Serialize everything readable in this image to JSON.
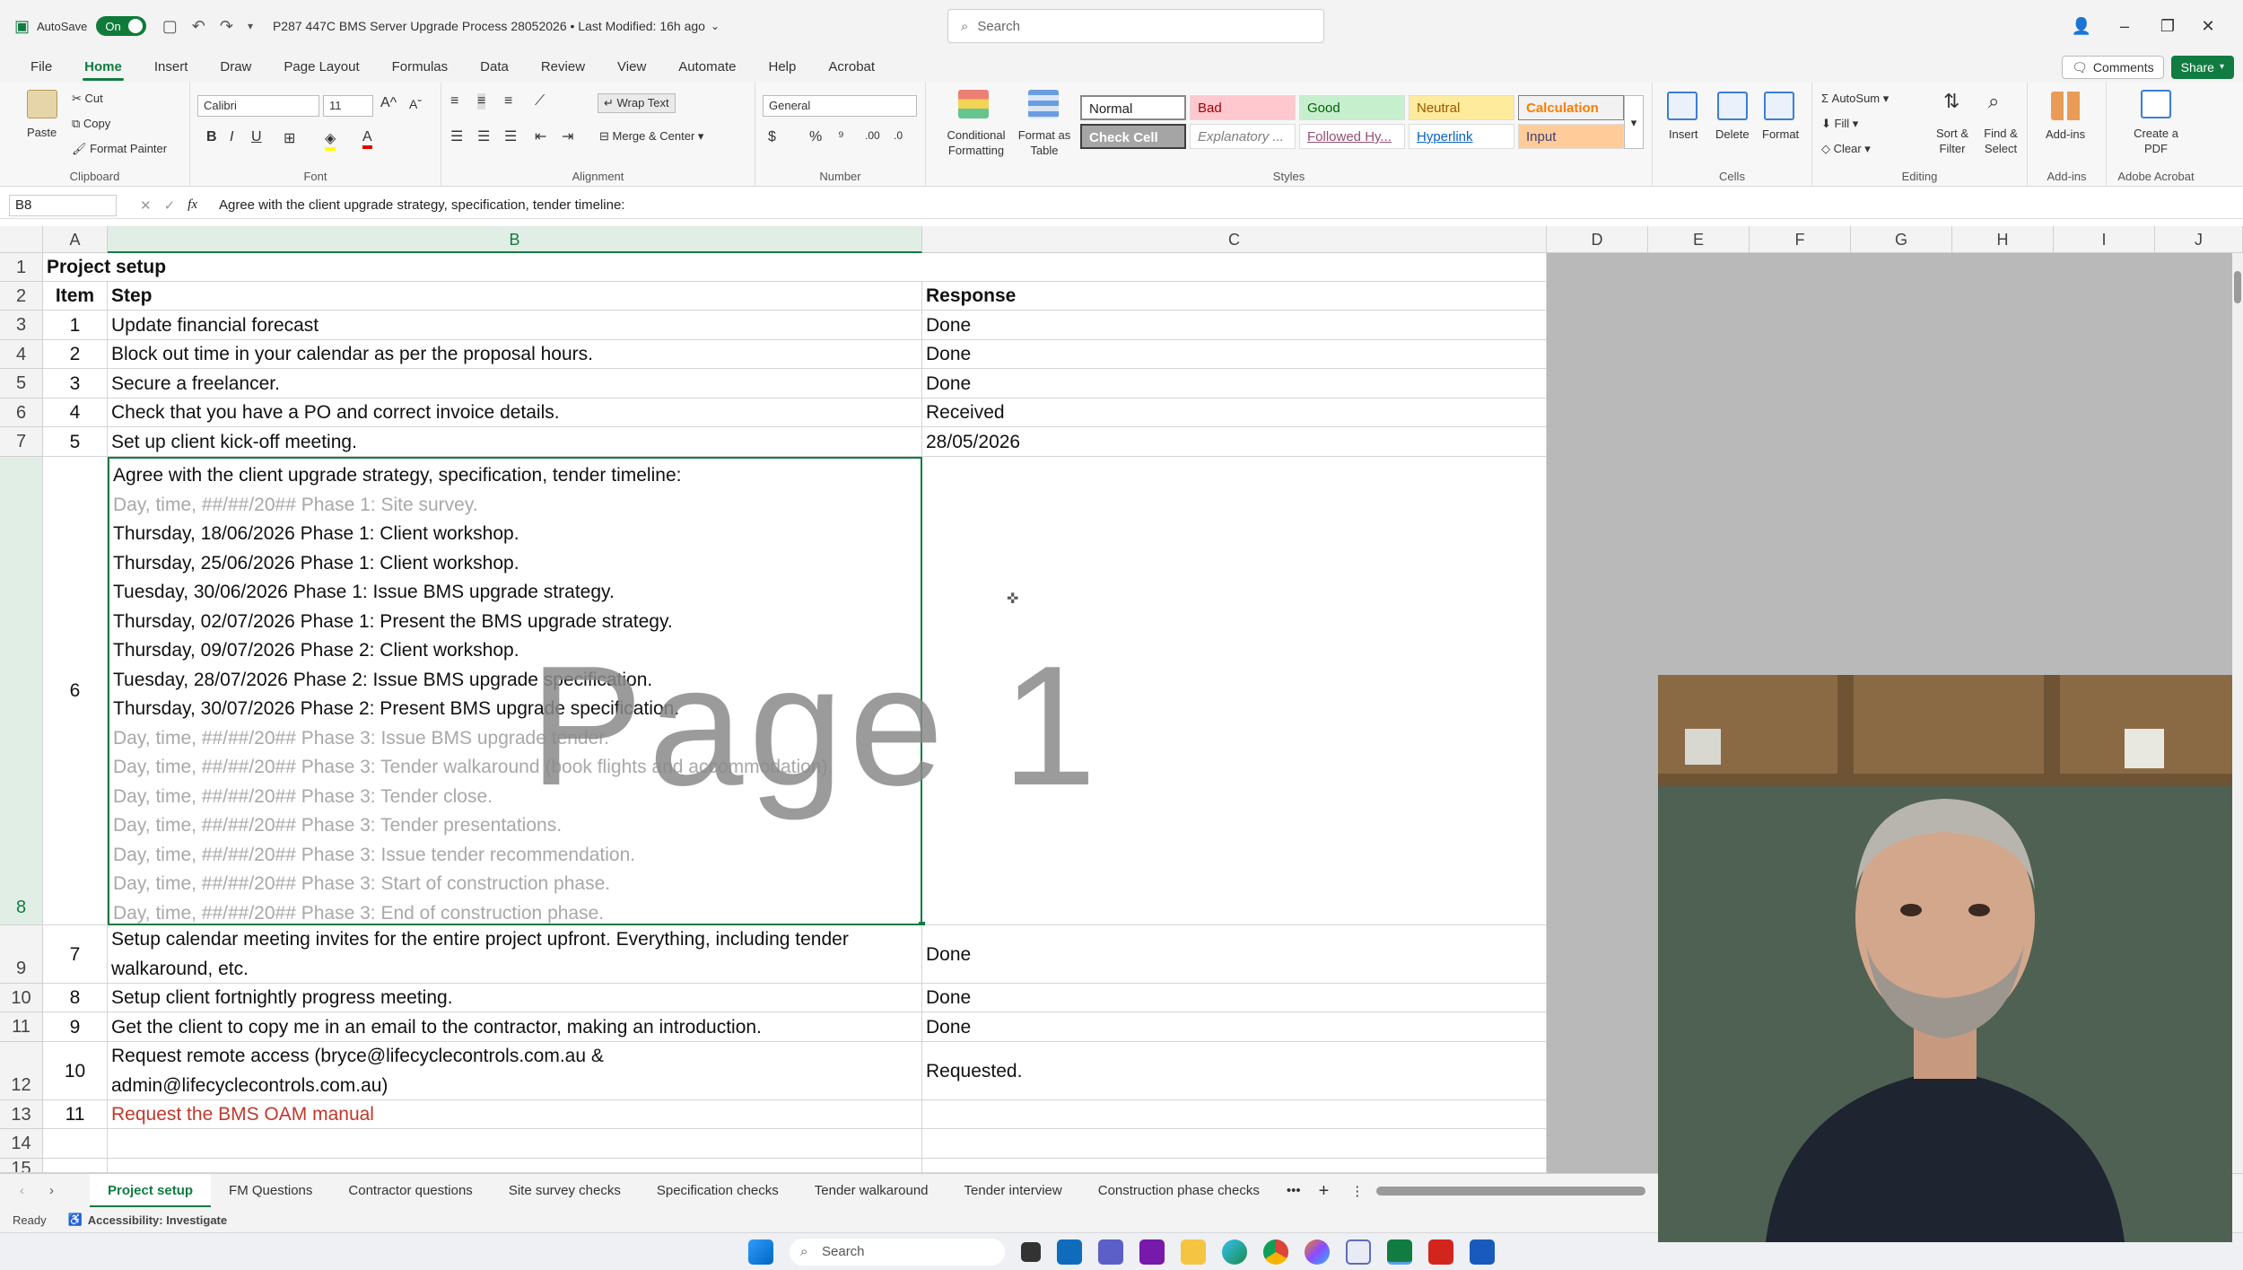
{
  "titlebar": {
    "autosave_label": "AutoSave",
    "autosave_state": "On",
    "file_title": "P287 447C BMS Server Upgrade Process 28052026 • Last Modified: 16h ago",
    "search_placeholder": "Search"
  },
  "menu": {
    "items": [
      "File",
      "Home",
      "Insert",
      "Draw",
      "Page Layout",
      "Formulas",
      "Data",
      "Review",
      "View",
      "Automate",
      "Help",
      "Acrobat"
    ],
    "active": "Home",
    "comments_label": "Comments",
    "share_label": "Share"
  },
  "ribbon": {
    "clipboard": {
      "paste": "Paste",
      "cut": "Cut",
      "copy": "Copy",
      "format_painter": "Format Painter",
      "label": "Clipboard"
    },
    "font": {
      "name": "Calibri",
      "size": "11",
      "label": "Font"
    },
    "alignment": {
      "wrap_text": "Wrap Text",
      "merge_center": "Merge & Center",
      "label": "Alignment"
    },
    "number": {
      "format": "General",
      "label": "Number"
    },
    "styles": {
      "conditional_formatting": "Conditional Formatting",
      "format_as_table": "Format as Table",
      "normal": "Normal",
      "bad": "Bad",
      "good": "Good",
      "neutral": "Neutral",
      "calculation": "Calculation",
      "check_cell": "Check Cell",
      "explanatory": "Explanatory ...",
      "followed_hyperlink": "Followed Hy...",
      "hyperlink": "Hyperlink",
      "input": "Input",
      "label": "Styles"
    },
    "cells": {
      "insert": "Insert",
      "delete": "Delete",
      "format": "Format",
      "label": "Cells"
    },
    "editing": {
      "autosum": "AutoSum",
      "fill": "Fill",
      "clear": "Clear",
      "sort_filter": "Sort & Filter",
      "find_select": "Find & Select",
      "label": "Editing"
    },
    "addins": {
      "addins": "Add-ins",
      "label": "Add-ins"
    },
    "acrobat": {
      "create_pdf": "Create a PDF",
      "label": "Adobe Acrobat"
    }
  },
  "formula_bar": {
    "name_box": "B8",
    "fx": "fx",
    "content": "Agree with the client upgrade strategy, specification, tender timeline:"
  },
  "columns": [
    "A",
    "B",
    "C",
    "D",
    "E",
    "F",
    "G",
    "H",
    "I",
    "J"
  ],
  "rows": [
    "1",
    "2",
    "3",
    "4",
    "5",
    "6",
    "7",
    "8",
    "9",
    "10",
    "11",
    "12",
    "13",
    "14",
    "15"
  ],
  "sheet": {
    "title": "Project setup",
    "headers": {
      "item": "Item",
      "step": "Step",
      "response": "Response"
    },
    "r3": {
      "item": "1",
      "step": "Update financial forecast",
      "response": "Done"
    },
    "r4": {
      "item": "2",
      "step": "Block out time in your calendar as per the proposal hours.",
      "response": "Done"
    },
    "r5": {
      "item": "3",
      "step": "Secure a freelancer.",
      "response": "Done"
    },
    "r6": {
      "item": "4",
      "step": "Check that you have a PO and correct invoice details.",
      "response": "Received"
    },
    "r7": {
      "item": "5",
      "step": "Set up client kick-off meeting.",
      "response": "28/05/2026"
    },
    "r8": {
      "item": "6",
      "lines": [
        "Agree with the client upgrade strategy, specification, tender timeline:",
        "Day, time, ##/##/20## Phase 1: Site survey.",
        "Thursday, 18/06/2026 Phase 1: Client workshop.",
        "Thursday, 25/06/2026 Phase 1: Client workshop.",
        "Tuesday, 30/06/2026 Phase 1: Issue BMS upgrade strategy.",
        "Thursday, 02/07/2026 Phase 1: Present the BMS upgrade strategy.",
        "Thursday, 09/07/2026 Phase 2: Client workshop.",
        "Tuesday, 28/07/2026 Phase 2: Issue BMS upgrade specification.",
        "Thursday, 30/07/2026 Phase 2: Present BMS upgrade specification.",
        "Day, time, ##/##/20## Phase 3: Issue BMS upgrade tender.",
        "Day, time, ##/##/20## Phase 3: Tender walkaround (book flights and accommodation).",
        "Day, time, ##/##/20## Phase 3: Tender close.",
        "Day, time, ##/##/20## Phase 3: Tender presentations.",
        "Day, time, ##/##/20## Phase 3: Issue tender recommendation.",
        "Day, time, ##/##/20## Phase 3: Start of construction phase.",
        "Day, time, ##/##/20## Phase 3: End of construction phase."
      ]
    },
    "r9": {
      "item": "7",
      "step_l1": "Setup calendar meeting invites for the entire project upfront. Everything, including tender",
      "step_l2": "walkaround, etc.",
      "response": "Done"
    },
    "r10": {
      "item": "8",
      "step": "Setup client fortnightly progress meeting.",
      "response": "Done"
    },
    "r11": {
      "item": "9",
      "step": "Get the client to copy me in an email to the contractor, making an introduction.",
      "response": "Done"
    },
    "r12": {
      "item": "10",
      "step_l1": "Request remote access (bryce@lifecyclecontrols.com.au &",
      "step_l2": "admin@lifecyclecontrols.com.au)",
      "response": "Requested."
    },
    "r13": {
      "item": "11",
      "step": "Request the BMS OAM manual",
      "response": ""
    }
  },
  "watermark": "Page 1",
  "tabs": [
    "Project setup",
    "FM Questions",
    "Contractor questions",
    "Site survey checks",
    "Specification checks",
    "Tender walkaround",
    "Tender interview",
    "Construction phase checks"
  ],
  "tabs_more": "•••",
  "tabs_add": "+",
  "status": {
    "ready": "Ready",
    "accessibility": "Accessibility: Investigate"
  },
  "taskbar": {
    "search": "Search"
  }
}
